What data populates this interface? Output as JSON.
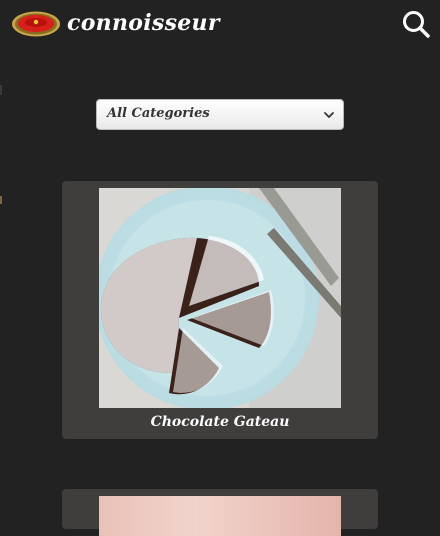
{
  "header": {
    "brand": "connoisseur",
    "logo_icon": "red-ring-logo-icon",
    "search_icon": "search-icon"
  },
  "filter": {
    "selected": "All Categories"
  },
  "recipes": [
    {
      "title": "Chocolate Gateau",
      "image": "chocolate-cake-photo"
    },
    {
      "title": "",
      "image": "pink-dish-photo"
    }
  ],
  "colors": {
    "background": "#222222",
    "card": "#403e3d",
    "accent": "#d8201a"
  }
}
